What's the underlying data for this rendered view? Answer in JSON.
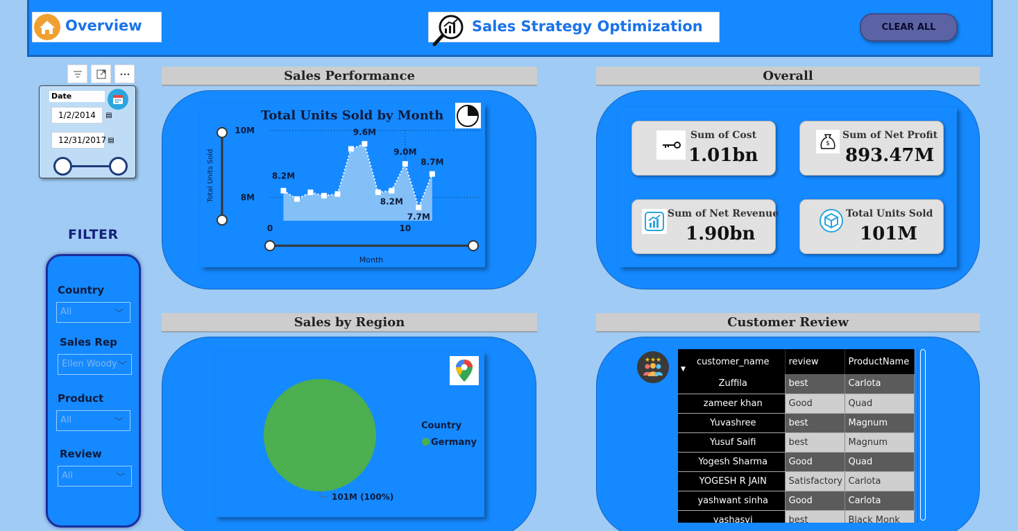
{
  "header": {
    "page_title": "Overview",
    "app_title": "Sales Strategy Optimization",
    "clear_button": "CLEAR ALL"
  },
  "date_slicer": {
    "label": "Date",
    "start": "1/2/2014",
    "end": "12/31/2017"
  },
  "filter": {
    "title": "FILTER",
    "fields": [
      {
        "label": "Country",
        "value": "All"
      },
      {
        "label": "Sales Rep",
        "value": "Ellen Woody"
      },
      {
        "label": "Product",
        "value": "All"
      },
      {
        "label": "Review",
        "value": "All"
      }
    ]
  },
  "sections": {
    "performance": "Sales Performance",
    "overall": "Overall",
    "region": "Sales by Region",
    "review": "Customer Review"
  },
  "chart_data": [
    {
      "type": "area",
      "title": "Total Units Sold by Month",
      "xlabel": "Month",
      "ylabel": "Total Units Sold",
      "x": [
        1,
        2,
        3,
        4,
        5,
        6,
        7,
        8,
        9,
        10,
        11,
        12
      ],
      "values": [
        8.2,
        7.95,
        8.15,
        8.05,
        8.1,
        9.45,
        9.6,
        8.15,
        8.2,
        9.0,
        7.7,
        8.7
      ],
      "ylim": [
        7.3,
        10.0
      ],
      "y_ticks": [
        "8M",
        "10M"
      ],
      "x_ticks": [
        "0",
        "10"
      ],
      "data_labels": [
        {
          "x": 1,
          "text": "8.2M"
        },
        {
          "x": 7,
          "text": "9.6M"
        },
        {
          "x": 9,
          "text": "8.2M"
        },
        {
          "x": 10,
          "text": "9.0M"
        },
        {
          "x": 11,
          "text": "7.7M"
        },
        {
          "x": 12,
          "text": "8.7M"
        }
      ]
    },
    {
      "type": "pie",
      "legend_title": "Country",
      "slices": [
        {
          "name": "Germany",
          "value": 101,
          "label": "101M (100%)",
          "color": "#4caf50"
        }
      ]
    }
  ],
  "kpis": [
    {
      "label": "Sum of Cost",
      "value": "1.01bn",
      "icon": "key-icon"
    },
    {
      "label": "Sum of Net Profit",
      "value": "893.47M",
      "icon": "money-bag-icon"
    },
    {
      "label": "Sum of Net Revenue",
      "value": "1.90bn",
      "icon": "growth-chart-icon"
    },
    {
      "label": "Total Units Sold",
      "value": "101M",
      "icon": "cube-icon"
    }
  ],
  "review_table": {
    "columns": [
      "customer_name",
      "review",
      "ProductName"
    ],
    "rows": [
      [
        "Zuffila",
        "best",
        "Carlota"
      ],
      [
        "zameer khan",
        "Good",
        "Quad"
      ],
      [
        "Yuvashree",
        "best",
        "Magnum"
      ],
      [
        "Yusuf Saifi",
        "best",
        "Magnum"
      ],
      [
        "Yogesh Sharma",
        "Good",
        "Quad"
      ],
      [
        "YOGESH R JAIN",
        "Satisfactory",
        "Carlota"
      ],
      [
        "yashwant sinha",
        "Good",
        "Carlota"
      ],
      [
        "yashasvi",
        "best",
        "Black Monk"
      ]
    ]
  },
  "colors": {
    "background": "#9fcbf5",
    "panel": "#1589ff",
    "accent": "#1a73e8",
    "pie": "#4caf50"
  }
}
